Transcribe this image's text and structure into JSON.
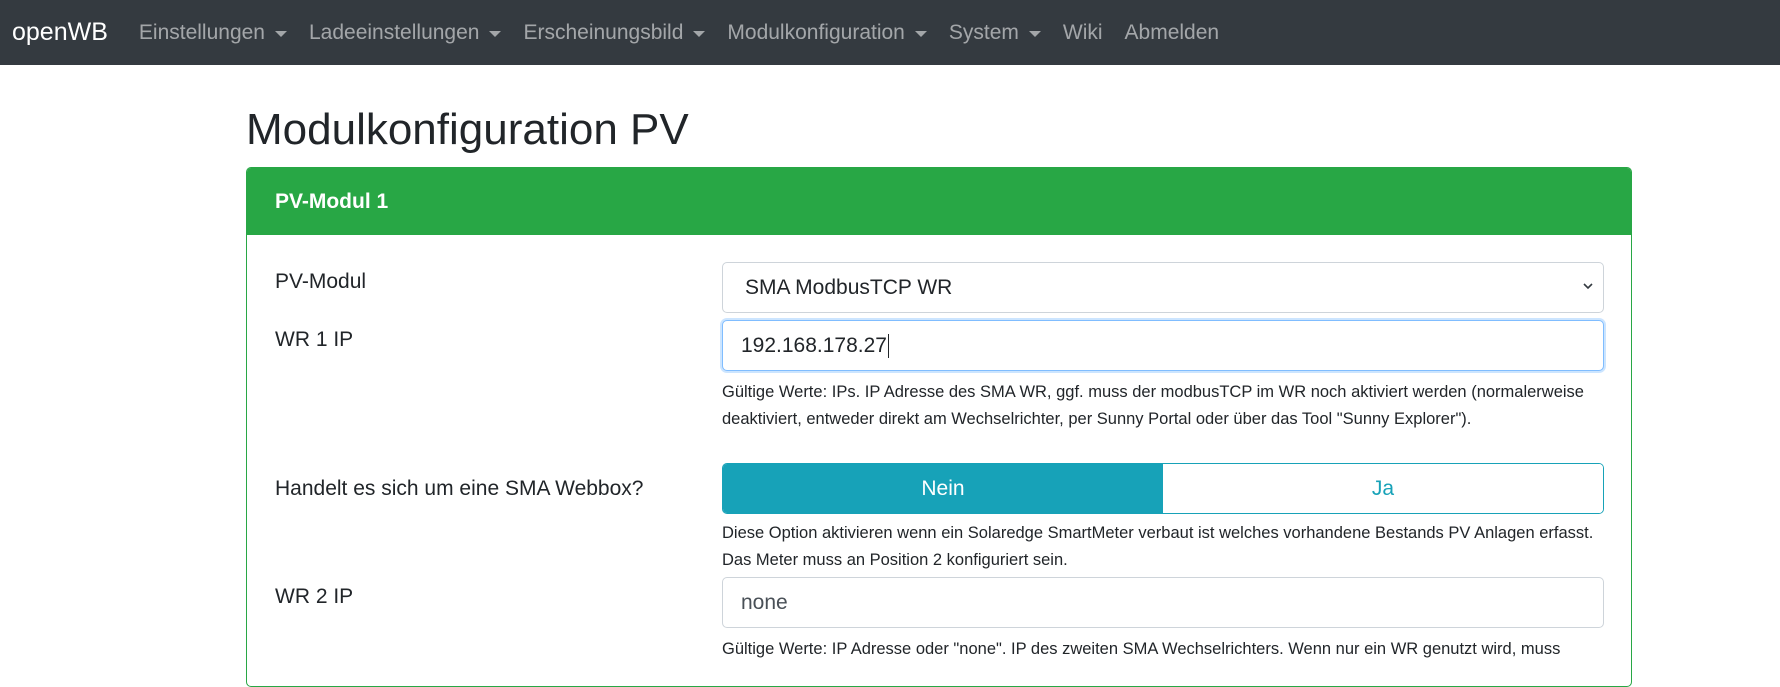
{
  "navbar": {
    "brand": "openWB",
    "items": [
      {
        "label": "Einstellungen",
        "dropdown": true
      },
      {
        "label": "Ladeeinstellungen",
        "dropdown": true
      },
      {
        "label": "Erscheinungsbild",
        "dropdown": true
      },
      {
        "label": "Modulkonfiguration",
        "dropdown": true
      },
      {
        "label": "System",
        "dropdown": true
      },
      {
        "label": "Wiki",
        "dropdown": false
      },
      {
        "label": "Abmelden",
        "dropdown": false
      }
    ]
  },
  "page": {
    "title": "Modulkonfiguration PV"
  },
  "card": {
    "header": "PV-Modul 1",
    "pv_module": {
      "label": "PV-Modul",
      "selected": "SMA ModbusTCP WR"
    },
    "wr1_ip": {
      "label": "WR 1 IP",
      "value": "192.168.178.27",
      "help": "Gültige Werte: IPs. IP Adresse des SMA WR, ggf. muss der modbusTCP im WR noch aktiviert werden (normalerweise deaktiviert, entweder direkt am Wechselrichter, per Sunny Portal oder über das Tool \"Sunny Explorer\")."
    },
    "webbox": {
      "label": "Handelt es sich um eine SMA Webbox?",
      "option_no": "Nein",
      "option_yes": "Ja",
      "selected": "Nein",
      "help": "Diese Option aktivieren wenn ein Solaredge SmartMeter verbaut ist welches vorhandene Bestands PV Anlagen erfasst. Das Meter muss an Position 2 konfiguriert sein."
    },
    "wr2_ip": {
      "label": "WR 2 IP",
      "value": "none",
      "help": "Gültige Werte: IP Adresse oder \"none\". IP des zweiten SMA Wechselrichters. Wenn nur ein WR genutzt wird, muss"
    }
  },
  "colors": {
    "navbar_bg": "#343a40",
    "card_accent": "#28a745",
    "toggle_accent": "#17a2b8"
  }
}
